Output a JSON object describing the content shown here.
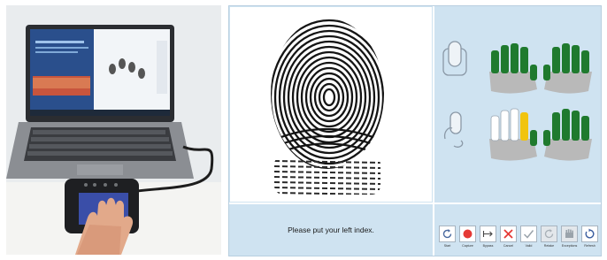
{
  "photo": {
    "alt": "Laptop connected to a fingerprint scanner with a hand placed on it"
  },
  "app": {
    "status_message": "Please put your left index.",
    "toolbar": [
      {
        "name": "start",
        "label": "Start",
        "icon": "restart-icon",
        "dim": false
      },
      {
        "name": "capture",
        "label": "Capture",
        "icon": "record-icon",
        "dim": false
      },
      {
        "name": "bypass",
        "label": "Bypass",
        "icon": "skip-arrow-icon",
        "dim": false
      },
      {
        "name": "cancel",
        "label": "Cancel",
        "icon": "close-icon",
        "dim": false
      },
      {
        "name": "valid",
        "label": "Valid",
        "icon": "checkmark-icon",
        "dim": false
      },
      {
        "name": "retake",
        "label": "Retake",
        "icon": "retake-icon",
        "dim": true
      },
      {
        "name": "exceptions",
        "label": "Exceptions",
        "icon": "hand-exception-icon",
        "dim": true
      },
      {
        "name": "refresh",
        "label": "Refresh",
        "icon": "refresh-icon",
        "dim": false
      }
    ],
    "colors": {
      "panel": "#cfe3f1",
      "finger_done": "#1f7a2e",
      "finger_pending": "#ffffff",
      "finger_current": "#f1c40f",
      "palm": "#b9b9b9",
      "capture_red": "#e53935",
      "cancel_red": "#e53935"
    }
  }
}
